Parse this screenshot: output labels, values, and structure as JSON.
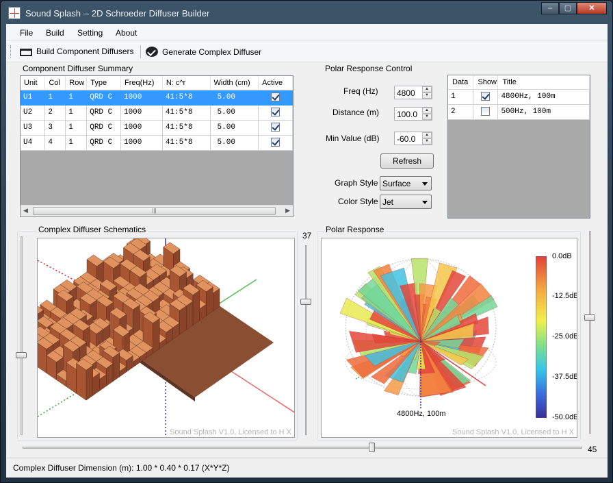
{
  "window": {
    "title": "Sound Splash -- 2D Schroeder Diffuser Builder",
    "minimize": "‒",
    "maximize": "▢",
    "close": "✕"
  },
  "menu": [
    "File",
    "Build",
    "Setting",
    "About"
  ],
  "toolbar": {
    "build_label": "Build Component Diffusers",
    "generate_label": "Generate Complex Diffuser"
  },
  "summary": {
    "title": "Component Diffuser Summary",
    "columns": [
      "Unit",
      "Col",
      "Row",
      "Type",
      "Freq(Hz)",
      "N: c^r",
      "Width (cm)",
      "Active"
    ],
    "rows": [
      [
        "U1",
        "1",
        "1",
        "QRD C",
        "1000",
        "41:5*8",
        "5.00",
        true
      ],
      [
        "U2",
        "2",
        "1",
        "QRD C",
        "1000",
        "41:5*8",
        "5.00",
        true
      ],
      [
        "U3",
        "3",
        "1",
        "QRD C",
        "1000",
        "41:5*8",
        "5.00",
        true
      ],
      [
        "U4",
        "4",
        "1",
        "QRD C",
        "1000",
        "41:5*8",
        "5.00",
        true
      ]
    ],
    "scroll_left": "◀",
    "scroll_right": "▶",
    "scroll_grip": "|||"
  },
  "polar_control": {
    "title": "Polar Response Control",
    "freq_label": "Freq (Hz)",
    "freq_value": "4800",
    "distance_label": "Distance (m)",
    "distance_value": "100.0",
    "min_label": "Min Value (dB)",
    "min_value": "-60.0",
    "refresh_label": "Refresh",
    "graph_style_label": "Graph Style",
    "graph_style_value": "Surface",
    "color_style_label": "Color Style",
    "color_style_value": "Jet",
    "spin_up": "▲",
    "spin_down": "▼"
  },
  "data_table": {
    "columns": [
      "Data",
      "Show",
      "Title"
    ],
    "rows": [
      {
        "data": "1",
        "show": true,
        "title": "4800Hz, 100m"
      },
      {
        "data": "2",
        "show": false,
        "title": "500Hz, 100m"
      }
    ]
  },
  "schematics": {
    "title": "Complex Diffuser Schematics",
    "watermark": "Sound Splash V1.0, Licensed to H X"
  },
  "slider_vertical_value": "37",
  "slider_horizontal_value": "45",
  "polar_response": {
    "title": "Polar Response",
    "caption": "4800Hz, 100m",
    "watermark": "Sound Splash V1.0, Licensed to H X",
    "colorbar_labels": [
      "0.0dB",
      "-12.5dB",
      "-25.0dB",
      "-37.5dB",
      "-50.0dB"
    ]
  },
  "status": "Complex Diffuser Dimension (m): 1.00 * 0.40 * 0.17 (X*Y*Z)",
  "colors": {
    "selection": "#3399ff",
    "diffuser_block": "#c8643c"
  }
}
